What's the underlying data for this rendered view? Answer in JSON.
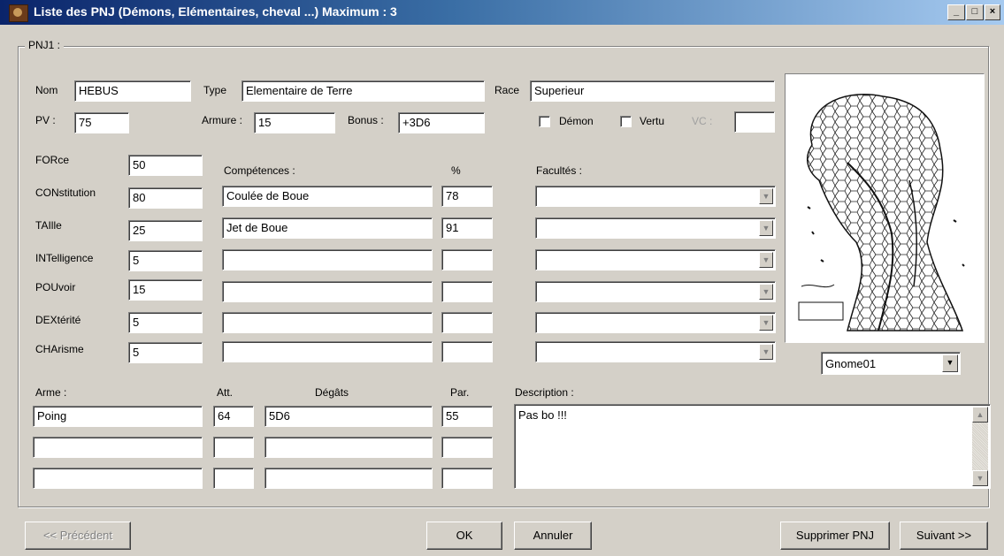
{
  "window": {
    "title": "Liste des PNJ (Démons, Elémentaires, cheval ...) Maximum : 3",
    "min_label": "_",
    "max_label": "□",
    "close_label": "×"
  },
  "group_label": "PNJ1 :",
  "identity": {
    "nom_label": "Nom",
    "nom_value": "HEBUS",
    "type_label": "Type",
    "type_value": "Elementaire de Terre",
    "race_label": "Race",
    "race_value": "Superieur",
    "pv_label": "PV :",
    "pv_value": "75",
    "armure_label": "Armure :",
    "armure_value": "15",
    "bonus_label": "Bonus :",
    "bonus_value": "+3D6",
    "demon_label": "Démon",
    "vertu_label": "Vertu",
    "vc_label": "VC :",
    "vc_value": ""
  },
  "characteristics": [
    {
      "label": "FORce",
      "value": "50"
    },
    {
      "label": "CONstitution",
      "value": "80"
    },
    {
      "label": "TAIlle",
      "value": "25"
    },
    {
      "label": "INTelligence",
      "value": "5"
    },
    {
      "label": "POUvoir",
      "value": "15"
    },
    {
      "label": "DEXtérité",
      "value": "5"
    },
    {
      "label": "CHArisme",
      "value": "5"
    }
  ],
  "competences_header": "Compétences :",
  "percent_header": "%",
  "facultes_header": "Facultés :",
  "competences": [
    {
      "name": "Coulée de Boue",
      "pct": "78"
    },
    {
      "name": "Jet de Boue",
      "pct": "91"
    },
    {
      "name": "",
      "pct": ""
    },
    {
      "name": "",
      "pct": ""
    },
    {
      "name": "",
      "pct": ""
    },
    {
      "name": "",
      "pct": ""
    }
  ],
  "weapons_headers": {
    "arme": "Arme :",
    "att": "Att.",
    "degats": "Dégâts",
    "par": "Par."
  },
  "weapons": [
    {
      "arme": "Poing",
      "att": "64",
      "degats": "5D6",
      "par": "55"
    },
    {
      "arme": "",
      "att": "",
      "degats": "",
      "par": ""
    },
    {
      "arme": "",
      "att": "",
      "degats": "",
      "par": ""
    }
  ],
  "description_label": "Description :",
  "description_value": "Pas bo !!!",
  "portrait_select": "Gnome01",
  "buttons": {
    "previous": "<< Précédent",
    "ok": "OK",
    "cancel": "Annuler",
    "delete": "Supprimer PNJ",
    "next": "Suivant >>"
  },
  "icons": {
    "dropdown": "chevron-down-icon",
    "scroll_up": "scroll-up-icon",
    "scroll_down": "scroll-down-icon"
  }
}
